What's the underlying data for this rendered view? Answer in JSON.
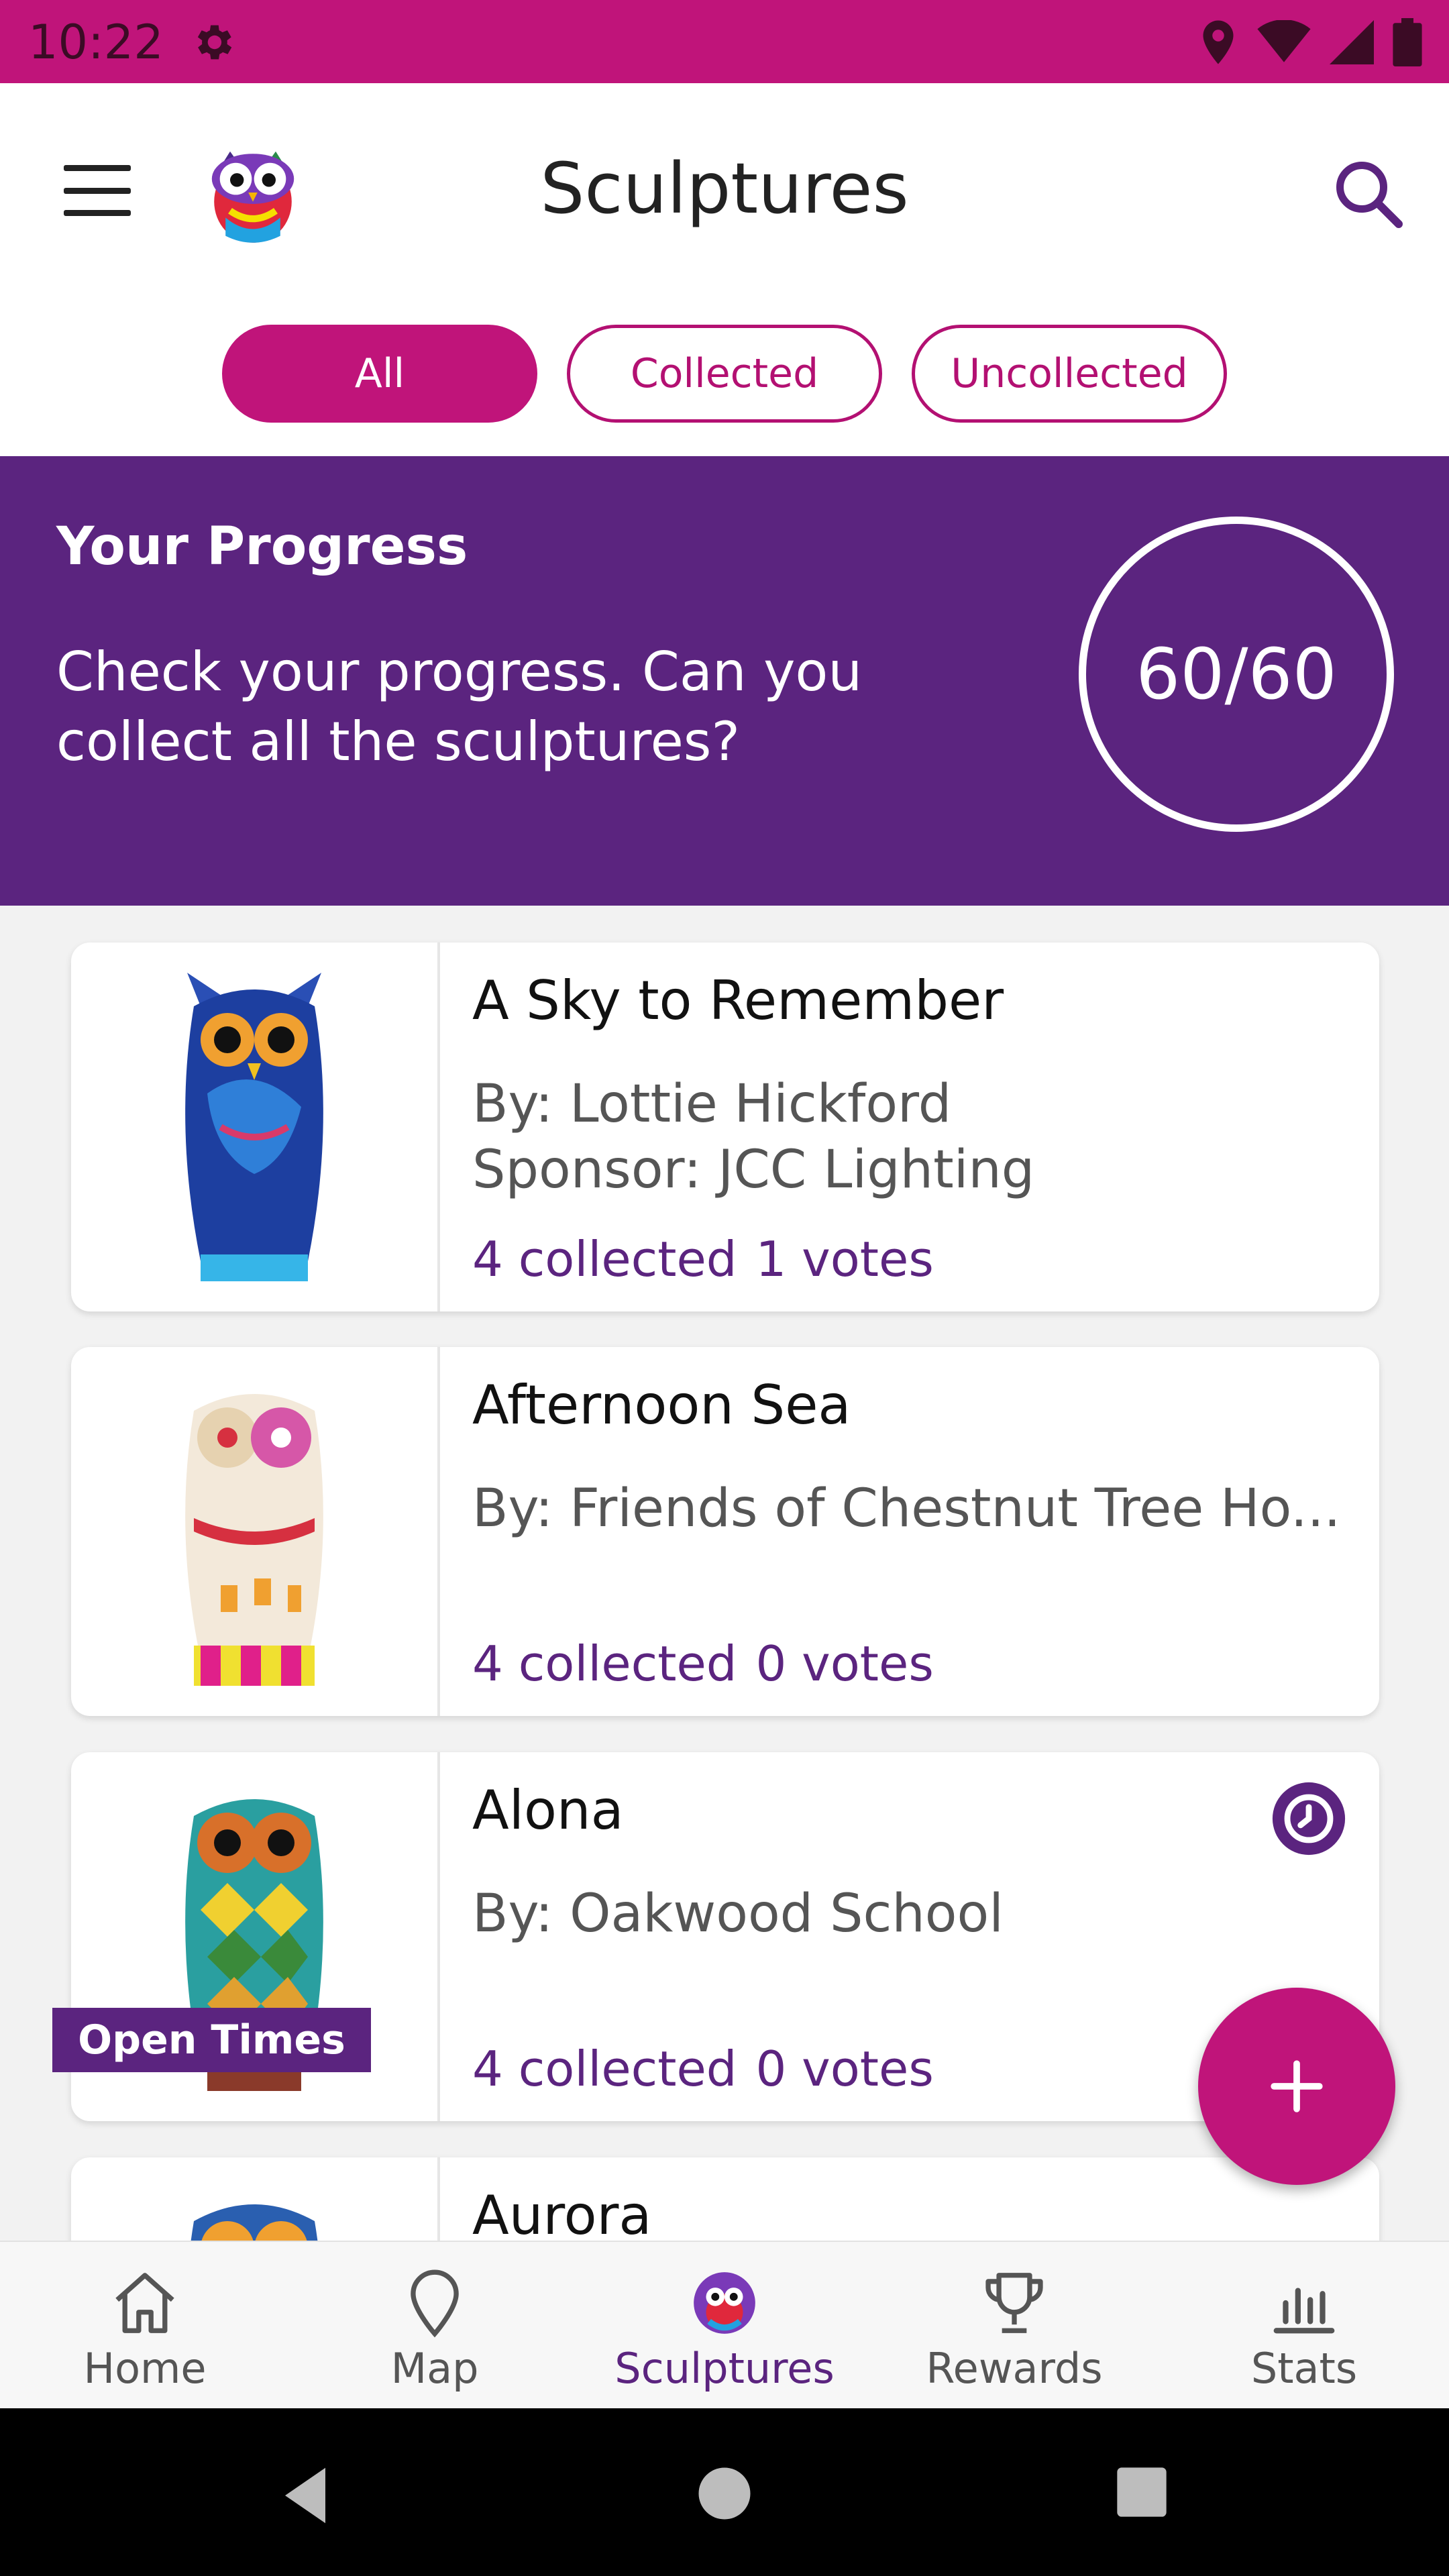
{
  "status_bar": {
    "time": "10:22"
  },
  "header": {
    "title": "Sculptures"
  },
  "filters": [
    "All",
    "Collected",
    "Uncollected"
  ],
  "progress": {
    "heading": "Your Progress",
    "description": "Check your progress. Can you collect all the sculptures?",
    "count": "60/60"
  },
  "sculptures": [
    {
      "name": "A Sky to Remember",
      "by": "By: Lottie Hickford",
      "sponsor": "Sponsor: JCC Lighting",
      "collected": "4 collected",
      "votes": "1 votes"
    },
    {
      "name": "Afternoon Sea",
      "by": "By: Friends of Chestnut Tree Ho...",
      "sponsor": "",
      "collected": "4 collected",
      "votes": "0 votes"
    },
    {
      "name": "Alona",
      "by": "By: Oakwood School",
      "sponsor": "",
      "collected": "4 collected",
      "votes": "0 votes",
      "badge": "Open Times"
    },
    {
      "name": "Aurora"
    }
  ],
  "bottom_nav": [
    {
      "label": "Home",
      "icon": "home-icon"
    },
    {
      "label": "Map",
      "icon": "map-pin-icon"
    },
    {
      "label": "Sculptures",
      "icon": "owl-icon"
    },
    {
      "label": "Rewards",
      "icon": "trophy-icon"
    },
    {
      "label": "Stats",
      "icon": "bar-chart-icon"
    }
  ],
  "colors": {
    "primary": "#c0147a",
    "secondary": "#5b247f"
  }
}
